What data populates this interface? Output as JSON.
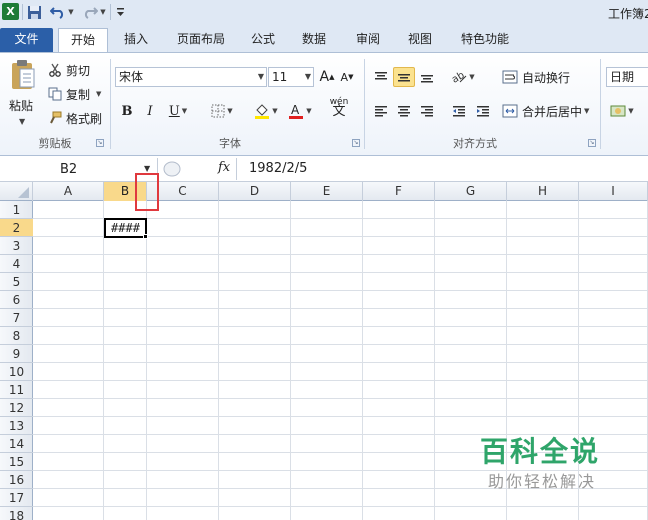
{
  "app": {
    "icon_glyph": "X",
    "window_title": "工作簿2"
  },
  "tabs": {
    "file": "文件",
    "home": "开始",
    "insert": "插入",
    "layout": "页面布局",
    "formula": "公式",
    "data": "数据",
    "review": "审阅",
    "view": "视图",
    "special": "特色功能"
  },
  "clipboard": {
    "paste": "粘贴",
    "cut": "剪切",
    "copy": "复制",
    "format_painter": "格式刷",
    "group": "剪贴板"
  },
  "font": {
    "name": "宋体",
    "size": "11",
    "group": "字体",
    "bold": "B",
    "italic": "I",
    "underline": "U",
    "grow": "A",
    "shrink": "A",
    "phonetic": "wén"
  },
  "alignment": {
    "wrap": "自动换行",
    "merge": "合并后居中",
    "group": "对齐方式"
  },
  "number": {
    "format": "日期"
  },
  "formula_bar": {
    "name_box": "B2",
    "fx": "fx",
    "value": "1982/2/5"
  },
  "sheet": {
    "columns": [
      "A",
      "B",
      "C",
      "D",
      "E",
      "F",
      "G",
      "H",
      "I"
    ],
    "rows": [
      "1",
      "2",
      "3",
      "4",
      "5",
      "6",
      "7",
      "8",
      "9",
      "10",
      "11",
      "12",
      "13",
      "14",
      "15",
      "16",
      "17",
      "18"
    ],
    "selected_column": "B",
    "selected_row": "2",
    "active_cell_display": "####"
  },
  "watermark": {
    "title": "百科全说",
    "subtitle": "助你轻松解决"
  },
  "colors": {
    "file_tab": "#2b5fa8",
    "highlight": "#f9d98b",
    "marker": "#e0393e",
    "watermark": "#2fa56a"
  }
}
